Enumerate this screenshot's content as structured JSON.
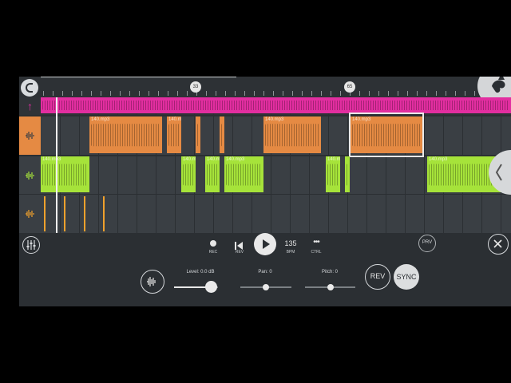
{
  "ruler": {
    "markers": [
      "33",
      "65"
    ]
  },
  "clip_name": "140.mp3",
  "transport": {
    "rec_label": "REC",
    "rev_label": "REV",
    "bpm_value": "135",
    "bpm_label": "BPM",
    "ctrl_label": "CTRL",
    "prv_label": "PRV"
  },
  "params": {
    "level_label": "Level: 0.0 dB",
    "pan_label": "Pan: 0",
    "pitch_label": "Pitch: 0",
    "level_value": 0.85,
    "pan_value": 0.5,
    "pitch_value": 0.5
  },
  "buttons": {
    "rev": "REV",
    "sync": "SYNC"
  },
  "colors": {
    "pink": "#e22ea0",
    "orange": "#e58a43",
    "green": "#a6e33a",
    "hit": "#f0a12c",
    "background": "#2b2f33"
  },
  "icons": {
    "snap": "magnet-icon",
    "logo": "fl-fruit-logo",
    "mixer": "mixer-icon",
    "record": "record-icon",
    "rewind": "rewind-icon",
    "play": "play-icon",
    "more": "more-icon",
    "close": "close-icon",
    "collapse": "chevron-left-icon",
    "waveform": "waveform-icon"
  }
}
